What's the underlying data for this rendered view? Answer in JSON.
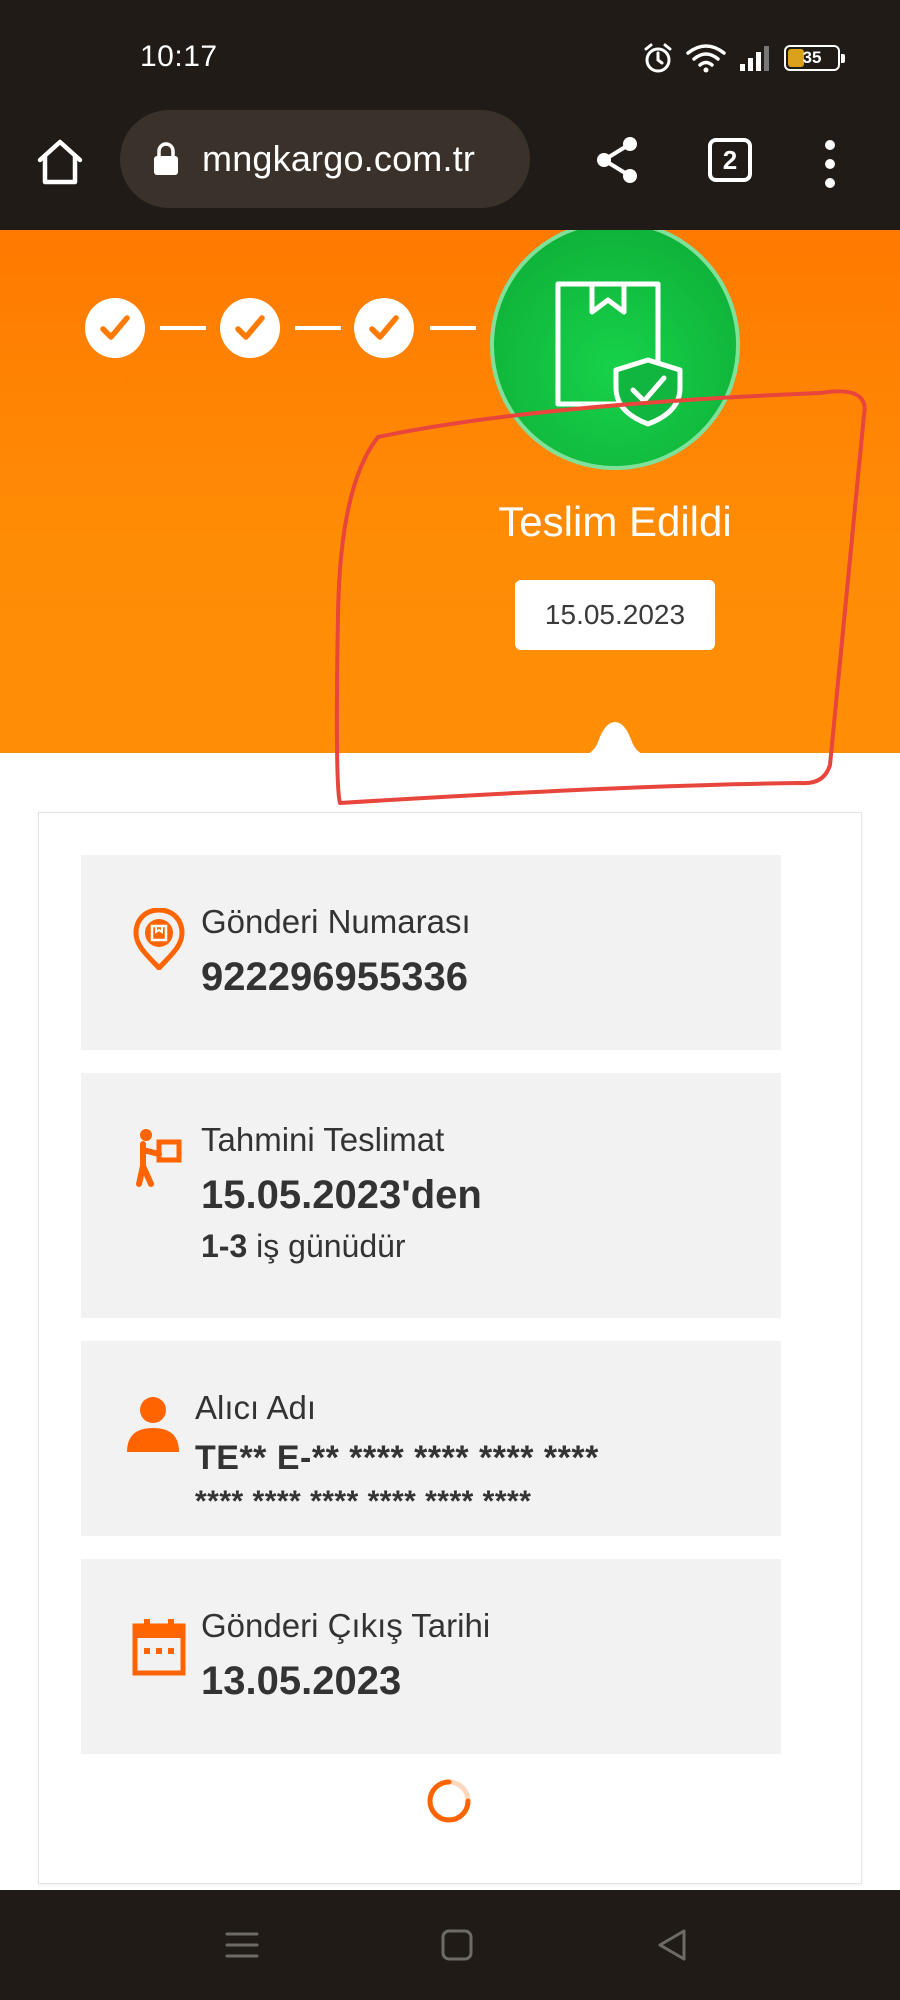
{
  "status_bar": {
    "time": "10:17",
    "battery_level": "35",
    "icons": [
      "alarm-icon",
      "wifi-icon",
      "signal-icon",
      "battery-icon"
    ]
  },
  "browser": {
    "url": "mngkargo.com.tr",
    "tab_count": "2"
  },
  "tracking": {
    "steps_completed": 3,
    "status": "Teslim Edildi",
    "status_date": "15.05.2023",
    "status_color": "#17c546",
    "brand_color": "#ff7a00"
  },
  "details": {
    "shipment_number_label": "Gönderi Numarası",
    "shipment_number": "922296955336",
    "estimated_delivery_label": "Tahmini Teslimat",
    "estimated_delivery_value": "15.05.2023'den",
    "estimated_delivery_range": "1-3",
    "estimated_delivery_suffix": " iş günüdür",
    "recipient_label": "Alıcı Adı",
    "recipient_line1": "TE** E-** **** **** **** ****",
    "recipient_line2": "**** **** **** **** **** ****",
    "dispatch_date_label": "Gönderi Çıkış Tarihi",
    "dispatch_date": "13.05.2023"
  },
  "nav": {
    "icons": [
      "recents-icon",
      "home-icon",
      "back-icon"
    ]
  }
}
